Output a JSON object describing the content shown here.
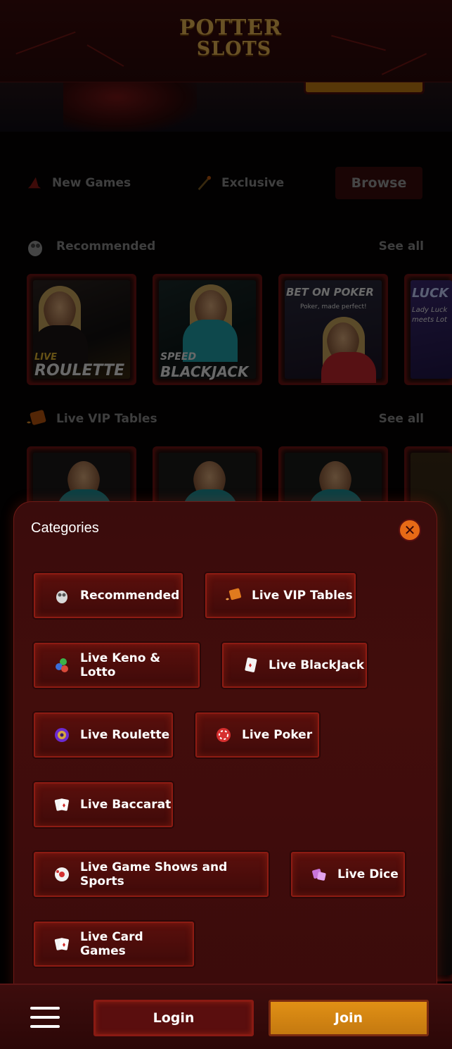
{
  "header": {
    "logo_line1": "POTTER",
    "logo_line2": "SLOTS"
  },
  "nav": {
    "new_games": "New Games",
    "exclusive": "Exclusive",
    "browse": "Browse"
  },
  "sections": {
    "recommended": {
      "title": "Recommended",
      "see_all": "See all",
      "games": [
        {
          "label_small": "LIVE",
          "label": "ROULETTE"
        },
        {
          "label_small": "SPEED",
          "label": "BLACKJACK"
        },
        {
          "label": "BET ON POKER",
          "sub": "Poker, made perfect!"
        },
        {
          "label": "LUCK",
          "sub": "Lady Luck meets Lot"
        }
      ]
    },
    "vip": {
      "title": "Live VIP Tables",
      "see_all": "See all"
    }
  },
  "categories": {
    "title": "Categories",
    "close_symbol": "✕",
    "items": [
      {
        "label": "Recommended",
        "icon": "owl-icon"
      },
      {
        "label": "Live VIP Tables",
        "icon": "ticket-icon"
      },
      {
        "label": "Live Keno & Lotto",
        "icon": "balls-icon"
      },
      {
        "label": "Live BlackJack",
        "icon": "card-icon"
      },
      {
        "label": "Live Roulette",
        "icon": "roulette-icon"
      },
      {
        "label": "Live Poker",
        "icon": "chip-icon"
      },
      {
        "label": "Live Baccarat",
        "icon": "cards-icon"
      },
      {
        "label": "Live Game Shows and Sports",
        "icon": "ball-icon"
      },
      {
        "label": "Live Dice",
        "icon": "dice-icon"
      },
      {
        "label": "Live Card Games",
        "icon": "playing-cards-icon"
      }
    ]
  },
  "bottom": {
    "login": "Login",
    "join": "Join"
  },
  "colors": {
    "accent": "#e19015",
    "primary_dark": "#3a0c0c",
    "border": "#8d1b13",
    "close": "#e76a16"
  }
}
